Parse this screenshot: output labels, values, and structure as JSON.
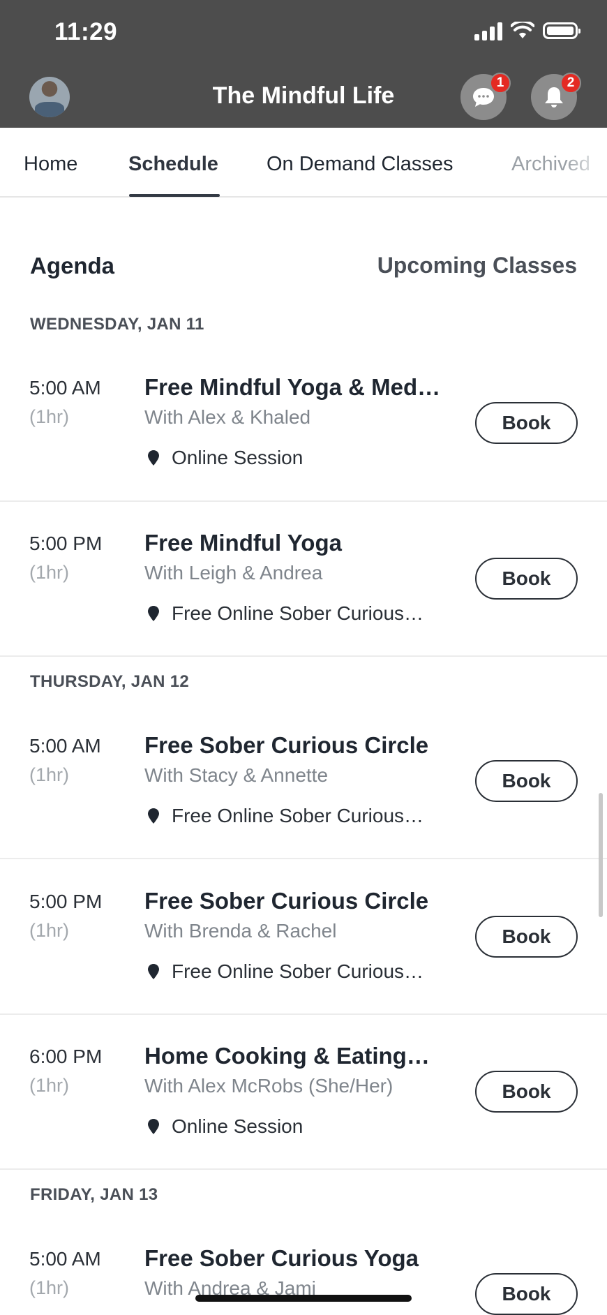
{
  "status_bar": {
    "time": "11:29"
  },
  "header": {
    "title": "The Mindful Life",
    "chat_badge": "1",
    "notifications_badge": "2"
  },
  "tabs": [
    "Home",
    "Schedule",
    "On Demand Classes",
    "Archived"
  ],
  "agenda": {
    "title": "Agenda",
    "upcoming_label": "Upcoming Classes"
  },
  "days": [
    {
      "label": "WEDNESDAY, JAN 11",
      "classes": [
        {
          "time": "5:00 AM",
          "duration": "(1hr)",
          "title": "Free Mindful Yoga & Med…",
          "instructors": "With Alex & Khaled",
          "location": "Online Session",
          "book": "Book"
        },
        {
          "time": "5:00 PM",
          "duration": "(1hr)",
          "title": "Free Mindful Yoga",
          "instructors": "With Leigh & Andrea",
          "location": "Free Online Sober Curious…",
          "book": "Book"
        }
      ]
    },
    {
      "label": "THURSDAY, JAN 12",
      "classes": [
        {
          "time": "5:00 AM",
          "duration": "(1hr)",
          "title": "Free Sober Curious Circle",
          "instructors": "With Stacy & Annette",
          "location": "Free Online Sober Curious…",
          "book": "Book"
        },
        {
          "time": "5:00 PM",
          "duration": "(1hr)",
          "title": "Free Sober Curious Circle",
          "instructors": "With Brenda & Rachel",
          "location": "Free Online Sober Curious…",
          "book": "Book"
        },
        {
          "time": "6:00 PM",
          "duration": "(1hr)",
          "title": "Home Cooking & Eating…",
          "instructors": "With Alex McRobs (She/Her)",
          "location": "Online Session",
          "book": "Book"
        }
      ]
    },
    {
      "label": "FRIDAY, JAN 13",
      "classes": [
        {
          "time": "5:00 AM",
          "duration": "(1hr)",
          "title": "Free Sober Curious Yoga",
          "instructors": "With Andrea & Jami",
          "book": "Book"
        }
      ]
    }
  ]
}
